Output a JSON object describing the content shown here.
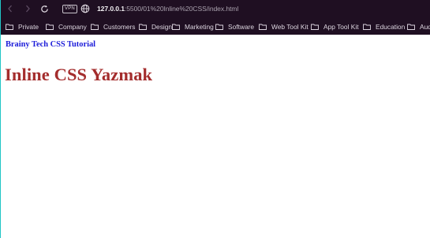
{
  "browser": {
    "vpn_badge": "VPN",
    "url_host": "127.0.0.1",
    "url_path": ":5500/01%20Inline%20CSS/index.html",
    "bookmarks": [
      {
        "label": "Private"
      },
      {
        "label": "Company"
      },
      {
        "label": "Customers"
      },
      {
        "label": "Design"
      },
      {
        "label": "Marketing"
      },
      {
        "label": "Software"
      },
      {
        "label": "Web Tool Kit"
      },
      {
        "label": "App Tool Kit"
      },
      {
        "label": "Education"
      },
      {
        "label": "Aud"
      }
    ],
    "colors": {
      "chrome_bg": "#1f0f22",
      "text": "#ddd6e0"
    }
  },
  "page": {
    "subtitle": "Brainy Tech CSS Tutorial",
    "title": "Inline CSS Yazmak",
    "colors": {
      "subtitle": "#1b1bd9",
      "title": "#a42d2d",
      "background": "#ffffff"
    }
  }
}
